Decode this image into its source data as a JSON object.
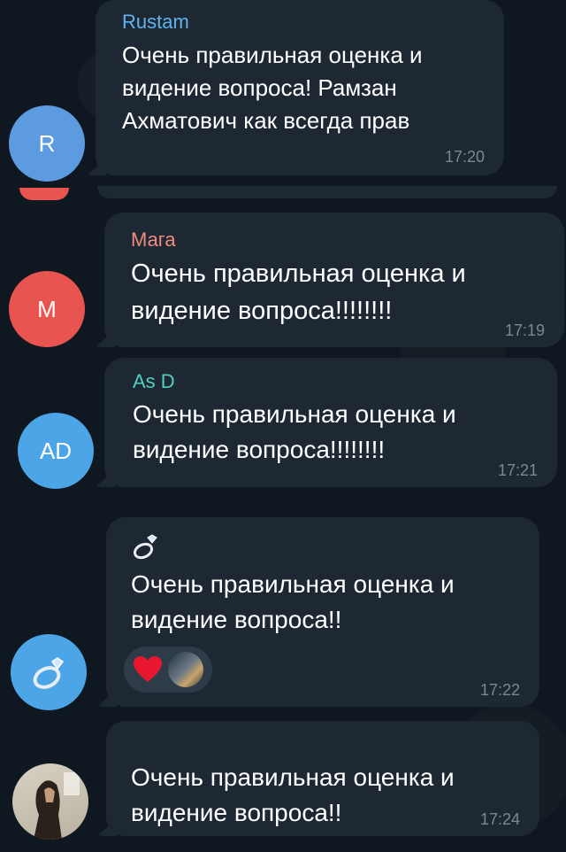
{
  "messages": [
    {
      "sender": "Rustam",
      "text": "Очень правильная оценка и видение вопроса!  Рамзан Ахматович как всегда прав",
      "time": "17:20",
      "avatar_initials": "R",
      "avatar_color": "#5c9be0",
      "sender_color": "#5fb3f0"
    },
    {
      "sender": "Мага",
      "text": "Очень правильная оценка и видение вопроса!!!!!!!!",
      "time": "17:19",
      "avatar_initials": "M",
      "avatar_color": "#e8544f",
      "sender_color": "#f08c80"
    },
    {
      "sender": "As D",
      "text": "Очень правильная оценка и видение вопроса!!!!!!!!",
      "time": "17:21",
      "avatar_initials": "AD",
      "avatar_color": "#4ba5e6",
      "sender_color": "#4fd0c0"
    },
    {
      "sender_icon": "ring-icon",
      "text": "Очень правильная оценка и видение вопроса!!",
      "time": "17:22",
      "avatar_icon": "ring-icon",
      "avatar_color": "#4ba5e6",
      "reactions": [
        "heart-icon",
        "reactor-avatar-icon"
      ]
    },
    {
      "text": "Очень правильная оценка и видение вопроса!!",
      "time": "17:24",
      "avatar_icon": "photo-avatar-icon"
    }
  ]
}
